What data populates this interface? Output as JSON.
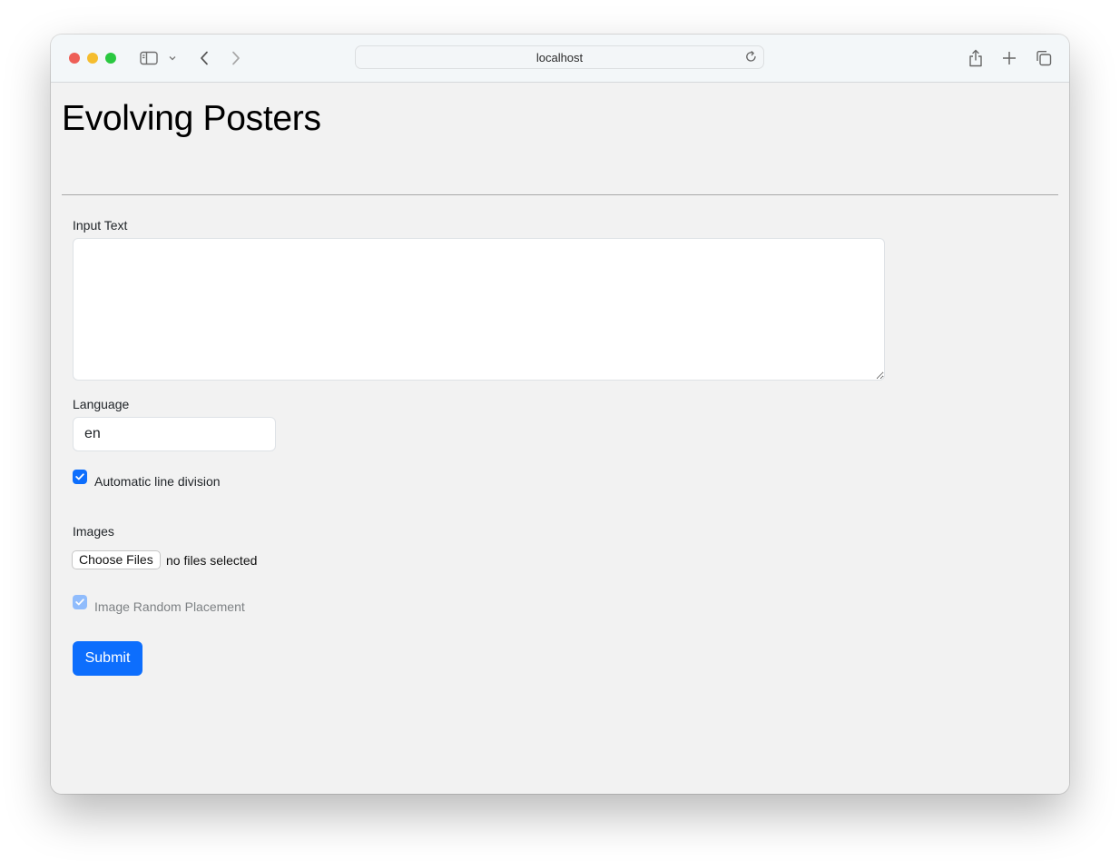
{
  "browser": {
    "url": "localhost",
    "icons": {
      "sidebar": "sidebar-icon",
      "sidebar_menu": "chevron-down-icon",
      "back": "chevron-left-icon",
      "forward": "chevron-right-icon",
      "reload": "reload-icon",
      "share": "share-icon",
      "new_tab": "plus-icon",
      "tabs": "tab-overview-icon"
    }
  },
  "page": {
    "title": "Evolving Posters",
    "form": {
      "input_text_label": "Input Text",
      "input_text_value": "",
      "language_label": "Language",
      "language_value": "en",
      "auto_line_label": "Automatic line division",
      "auto_line_checked": true,
      "images_label": "Images",
      "choose_files_label": "Choose Files",
      "file_status": "no files selected",
      "random_placement_label": "Image Random Placement",
      "random_placement_checked": true,
      "random_placement_disabled": true,
      "submit_label": "Submit"
    }
  },
  "colors": {
    "primary": "#0d6efd",
    "primary_disabled": "#86b7fe",
    "page_bg": "#f2f2f2"
  }
}
